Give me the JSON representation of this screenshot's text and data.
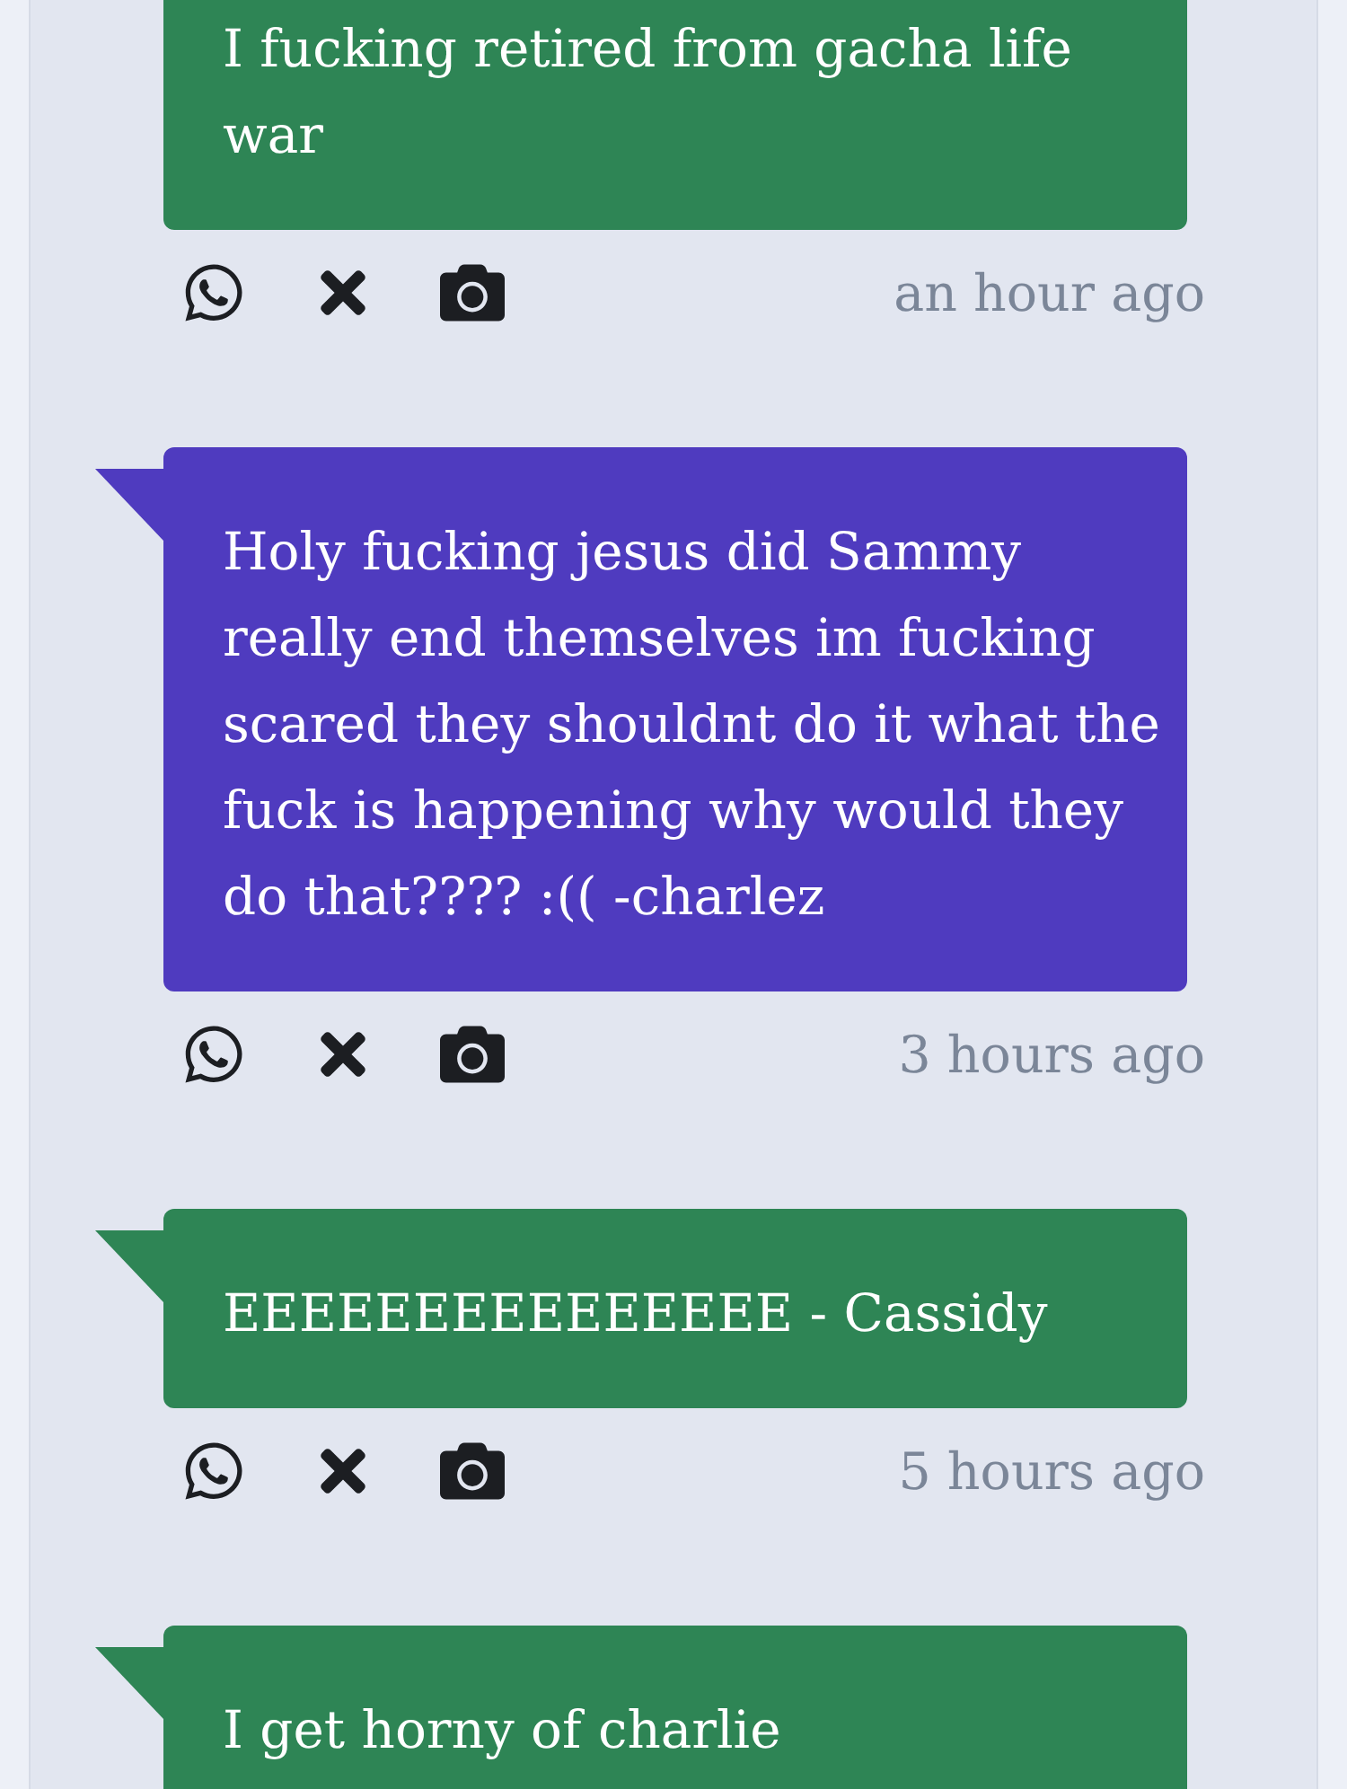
{
  "messages": [
    {
      "text": "I fucking retired from gacha life\nwar",
      "color": "#2e8555",
      "time": "an hour ago"
    },
    {
      "text": "Holy fucking jesus did Sammy\nreally end themselves im fucking\nscared they shouldnt do it what the\nfuck is happening why would they\ndo that???? :(( -charlez",
      "color": "#4f3bbf",
      "time": "3 hours ago"
    },
    {
      "text": "EEEEEEEEEEEEEEE - Cassidy",
      "color": "#2e8555",
      "time": "5 hours ago"
    },
    {
      "text": "I get horny of charlie",
      "color": "#2e8555"
    }
  ]
}
